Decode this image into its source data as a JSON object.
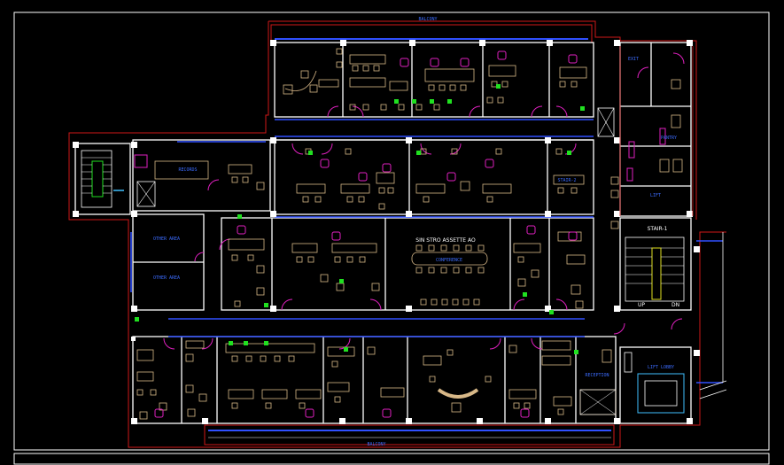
{
  "drawing": {
    "type": "office floor plan",
    "labels": {
      "balcony_top": "BALCONY",
      "balcony_bottom": "BALCONY",
      "records": "RECORDS",
      "stair": "STAIR-1",
      "stair_up": "UP",
      "stair_dn": "DN",
      "conference_title": "SIN STRO ASSETTE AO",
      "conference": "CONFERENCE",
      "other_area_1": "OTHER AREA",
      "other_area_2": "OTHER AREA",
      "pantry": "PANTRY",
      "exit": "EXIT",
      "reception": "RECEPTION",
      "lobby": "LIFT LOBBY",
      "elevator": "LIFT",
      "stair_right_label": "STAIR-2"
    },
    "colors": {
      "background": "#000000",
      "wall": "#ffffff",
      "boundary": "#d01818",
      "furniture": "#d8b888",
      "magenta": "#e020c0",
      "blue": "#3050ff",
      "green": "#20e020",
      "cyan": "#40c0ff"
    }
  }
}
